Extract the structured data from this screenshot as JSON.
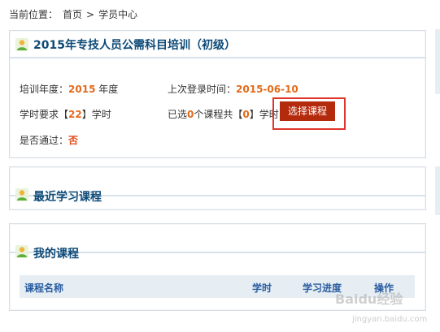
{
  "breadcrumb": {
    "label": "当前位置：",
    "home": "首页",
    "separator": ">",
    "current": "学员中心"
  },
  "course_panel": {
    "title": "2015年专技人员公需科目培训（初级）",
    "year_label": "培训年度：",
    "year_value": "2015",
    "year_suffix": "年度",
    "last_login_label": "上次登录时间：",
    "last_login_value": "2015-06-10",
    "hours_prefix": "学时要求【",
    "hours_value": "22",
    "hours_suffix": "】学时",
    "selected_prefix": "已选",
    "selected_count": "0",
    "selected_mid": "个课程共【",
    "selected_hours": "0",
    "selected_suffix": "】学时",
    "select_button": "选择课程",
    "passed_label": "是否通过：",
    "passed_value": "否"
  },
  "recent_panel": {
    "title": "最近学习课程"
  },
  "my_courses_panel": {
    "title": "我的课程",
    "columns": [
      "课程名称",
      "学时",
      "学习进度",
      "操作"
    ]
  },
  "watermark": {
    "text": "Baidu经验",
    "sub": "jingyan.baidu.com"
  },
  "colors": {
    "title_blue": "#0d4a78",
    "accent_orange": "#e26a1a",
    "button_red": "#b42a0c",
    "highlight_red": "#e0352b",
    "table_header_bg": "#e6eef4"
  }
}
